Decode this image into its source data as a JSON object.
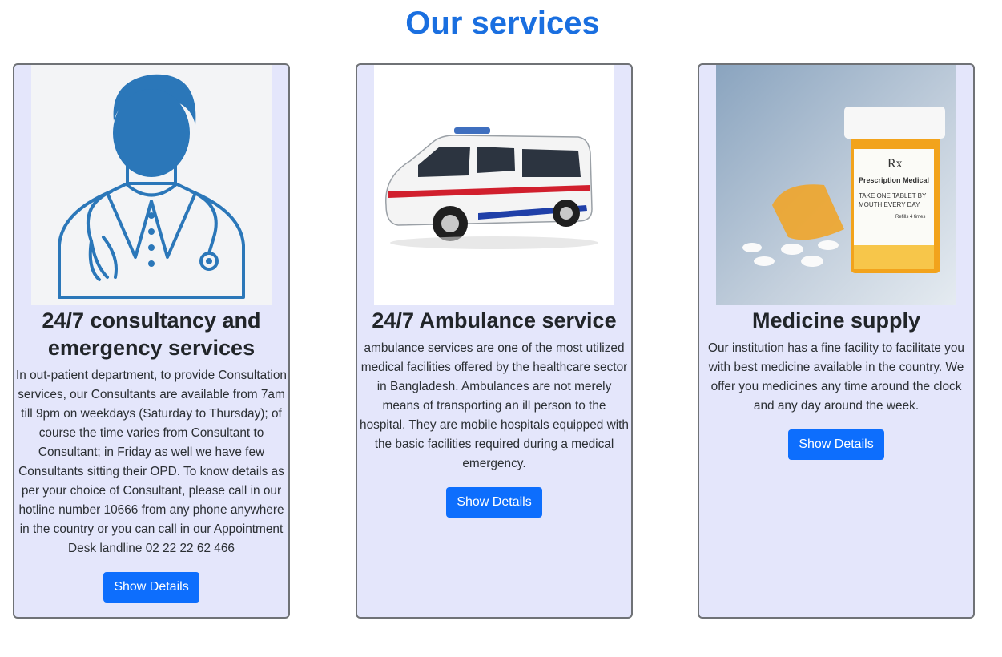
{
  "page": {
    "title": "Our services",
    "accent_color": "#1a6fe0",
    "button_color": "#0d6efd",
    "card_background": "#e4e6fb"
  },
  "services": [
    {
      "image": "doctor-illustration",
      "title": "24/7 consultancy and emergency services",
      "description": "In out-patient department, to provide Consultation services, our Consultants are available from 7am till 9pm on weekdays (Saturday to Thursday); of course the time varies from Consultant to Consultant; in Friday as well we have few Consultants sitting their OPD. To know details as per your choice of Consultant, please call in our hotline number 10666 from any phone anywhere in the country or you can call in our Appointment Desk landline 02 22 22 62 466",
      "button_label": "Show Details"
    },
    {
      "image": "ambulance-photo",
      "title": "24/7 Ambulance service",
      "description": "ambulance services are one of the most utilized medical facilities offered by the healthcare sector in Bangladesh. Ambulances are not merely means of transporting an ill person to the hospital. They are mobile hospitals equipped with the basic facilities required during a medical emergency.",
      "button_label": "Show Details"
    },
    {
      "image": "medicine-bottle-photo",
      "title": "Medicine supply",
      "description": "Our institution has a fine facility to facilitate you with best medicine available in the country. We offer you medicines any time around the clock and any day around the week.",
      "button_label": "Show Details",
      "image_text": {
        "rx": "Rx",
        "label_title": "Prescription Medical",
        "label_line1": "TAKE ONE TABLET BY",
        "label_line2": "MOUTH EVERY DAY",
        "label_line3": "Refills 4 times"
      }
    }
  ]
}
